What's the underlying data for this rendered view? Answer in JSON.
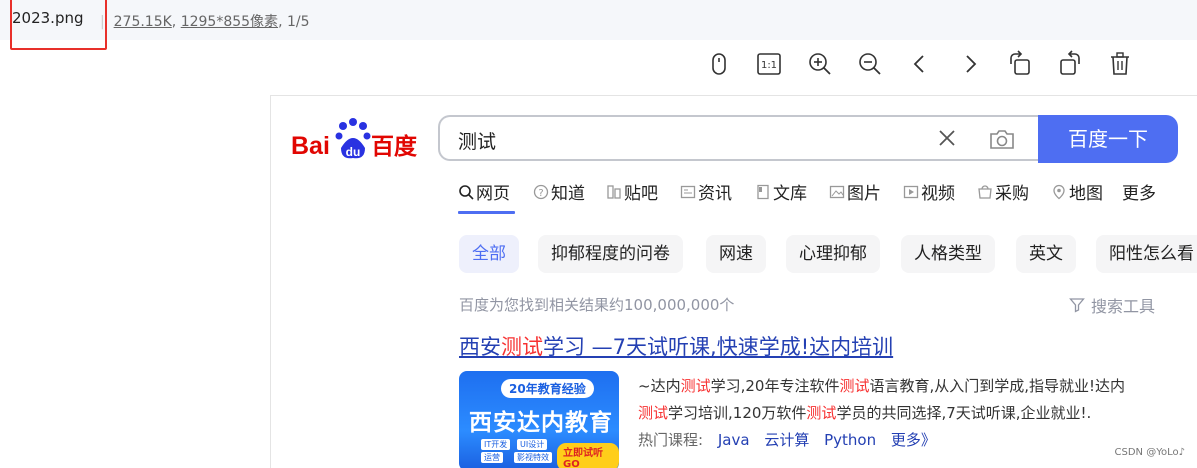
{
  "viewer": {
    "file_name": "2023.png",
    "file_size": "275.15K",
    "dimensions": "1295*855像素",
    "page_index": "1/5",
    "separator": ",",
    "toolbar_icons": [
      "mouse-icon",
      "actual-size-icon",
      "zoom-in-icon",
      "zoom-out-icon",
      "previous-icon",
      "next-icon",
      "rotate-left-icon",
      "rotate-right-icon",
      "delete-icon"
    ],
    "actual_size_label": "1:1"
  },
  "baidu": {
    "logo_text_left": "Bai",
    "logo_text_du": "du",
    "logo_text_cn": "百度",
    "query": "测试",
    "search_button": "百度一下",
    "tabs": [
      {
        "label": "网页",
        "icon": "search-icon",
        "active": true
      },
      {
        "label": "知道",
        "icon": "question-icon"
      },
      {
        "label": "贴吧",
        "icon": "tieba-icon"
      },
      {
        "label": "资讯",
        "icon": "news-icon"
      },
      {
        "label": "文库",
        "icon": "doc-icon"
      },
      {
        "label": "图片",
        "icon": "image-icon"
      },
      {
        "label": "视频",
        "icon": "video-icon"
      },
      {
        "label": "采购",
        "icon": "cart-icon"
      },
      {
        "label": "地图",
        "icon": "map-icon"
      },
      {
        "label": "更多",
        "icon": ""
      }
    ],
    "chips": [
      "全部",
      "抑郁程度的问卷",
      "网速",
      "心理抑郁",
      "人格类型",
      "英文",
      "阳性怎么看"
    ],
    "result_count": "百度为您找到相关结果约100,000,000个",
    "search_tools": "搜索工具",
    "result": {
      "title_pre": "西安",
      "title_hl": "测试",
      "title_post": "学习 —7天试听课,快速学成!达内培训",
      "thumb_tag": "20年教育经验",
      "thumb_title": "西安达内教育",
      "thumb_mini": [
        "IT开发",
        "UI设计",
        "运营",
        "影视特效"
      ],
      "thumb_cta": "立即试听 GO",
      "desc_parts": [
        {
          "t": "~达内",
          "hl": false
        },
        {
          "t": "测试",
          "hl": true
        },
        {
          "t": "学习,20年专注软件",
          "hl": false
        },
        {
          "t": "测试",
          "hl": true
        },
        {
          "t": "语言教育,从入门到学成,指导就业!达内",
          "hl": false
        },
        {
          "t": "测试",
          "hl": true
        },
        {
          "t": "学习培训,120万软件",
          "hl": false
        },
        {
          "t": "测试",
          "hl": true
        },
        {
          "t": "学员的共同选择,7天试听课,企业就业!.",
          "hl": false
        }
      ],
      "hot_label": "热门课程:",
      "hot_links": [
        "Java",
        "云计算",
        "Python",
        "更多》"
      ]
    }
  },
  "watermark": "CSDN @YoLo♪"
}
